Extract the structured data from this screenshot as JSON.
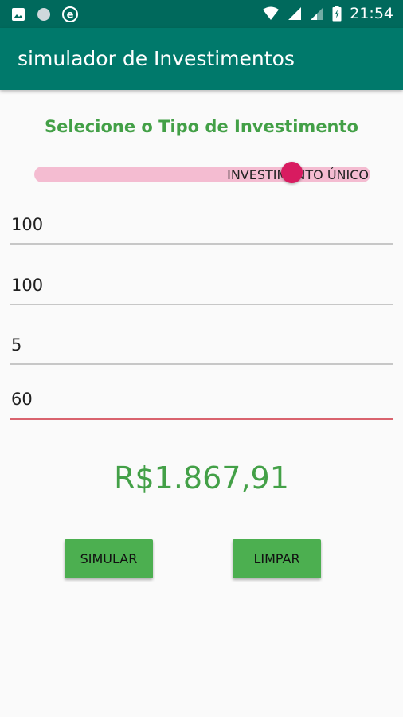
{
  "status_bar": {
    "time": "21:54",
    "icons": [
      "image-icon",
      "circle-icon",
      "e-icon",
      "wifi-icon",
      "signal-icon",
      "signal-icon-2",
      "battery-icon"
    ]
  },
  "app_bar": {
    "title": "simulador de Investimentos"
  },
  "main": {
    "heading": "Selecione o Tipo de Investimento",
    "toggle": {
      "label": "INVESTIMENTO ÚNICO",
      "checked": true
    },
    "fields": [
      {
        "value": "100"
      },
      {
        "value": "100"
      },
      {
        "value": "5"
      },
      {
        "value": "60"
      }
    ],
    "result": "R$1.867,91",
    "buttons": {
      "simulate": "SIMULAR",
      "clear": "LIMPAR"
    }
  },
  "colors": {
    "status_bar": "#00695c",
    "app_bar": "#00796b",
    "accent_green": "#43a047",
    "button_green": "#4caf50",
    "toggle_track": "#f4bcd1",
    "toggle_thumb": "#d81b60",
    "active_underline": "#d9636e"
  }
}
